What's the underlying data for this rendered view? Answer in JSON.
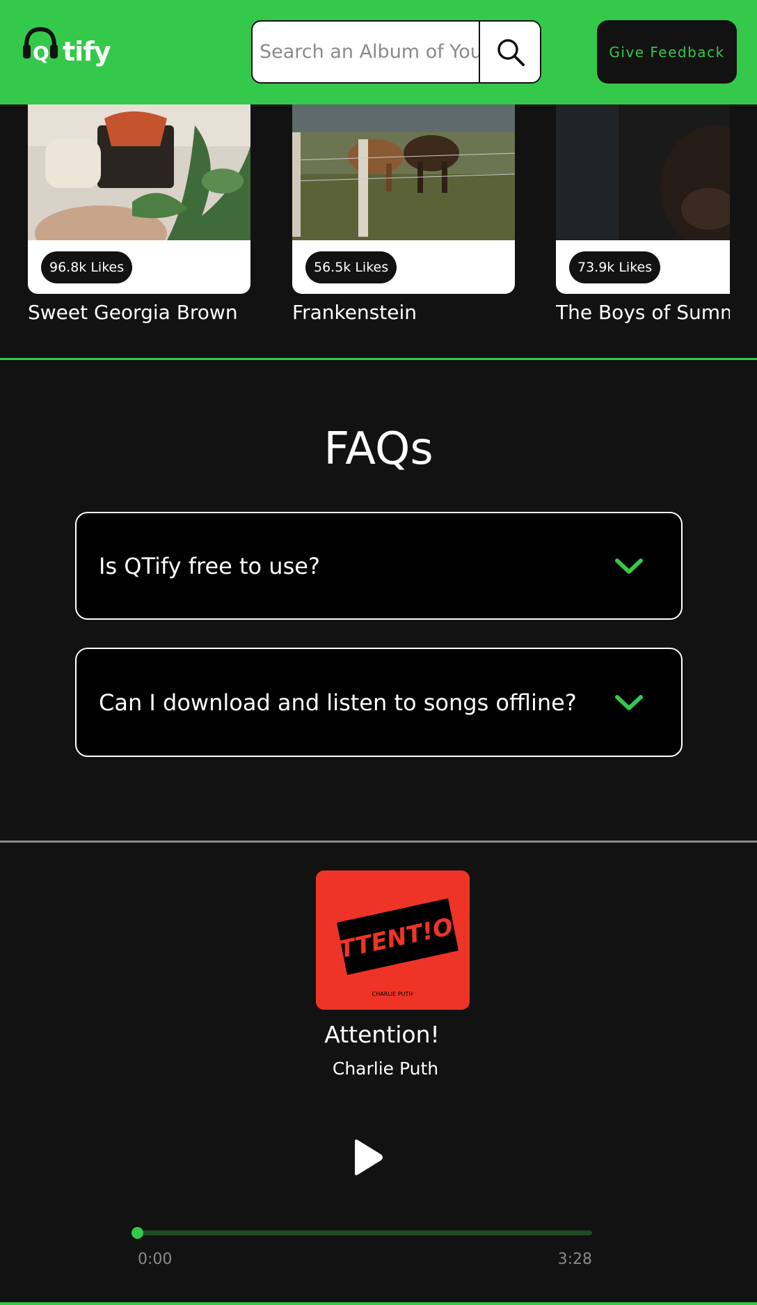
{
  "colors": {
    "brand_green": "#34c94a",
    "background": "#121212",
    "white": "#ffffff",
    "track_bg": "#1d4b26"
  },
  "navbar": {
    "logo_text": "tify",
    "logo_icon": "headphones-q-icon",
    "search": {
      "placeholder": "Search an Album of Your Choice",
      "icon": "search-icon"
    },
    "feedback_label": "Give Feedback"
  },
  "albums": [
    {
      "title": "Sweet Georgia Brown",
      "likes": "96.8k Likes"
    },
    {
      "title": "Frankenstein",
      "likes": "56.5k Likes"
    },
    {
      "title": "The Boys of Summer",
      "likes": "73.9k Likes"
    }
  ],
  "faq": {
    "heading": "FAQs",
    "items": [
      {
        "question": "Is QTify free to use?",
        "icon": "chevron-down-icon"
      },
      {
        "question": "Can I download and listen to songs offline?",
        "icon": "chevron-down-icon"
      }
    ]
  },
  "player": {
    "cover_text": "ATTENT!ON",
    "cover_subtext": "CHARLIE PUTH",
    "title": "Attention!",
    "artist": "Charlie Puth",
    "play_icon": "play-icon",
    "current_time": "0:00",
    "total_time": "3:28",
    "progress": 0
  }
}
